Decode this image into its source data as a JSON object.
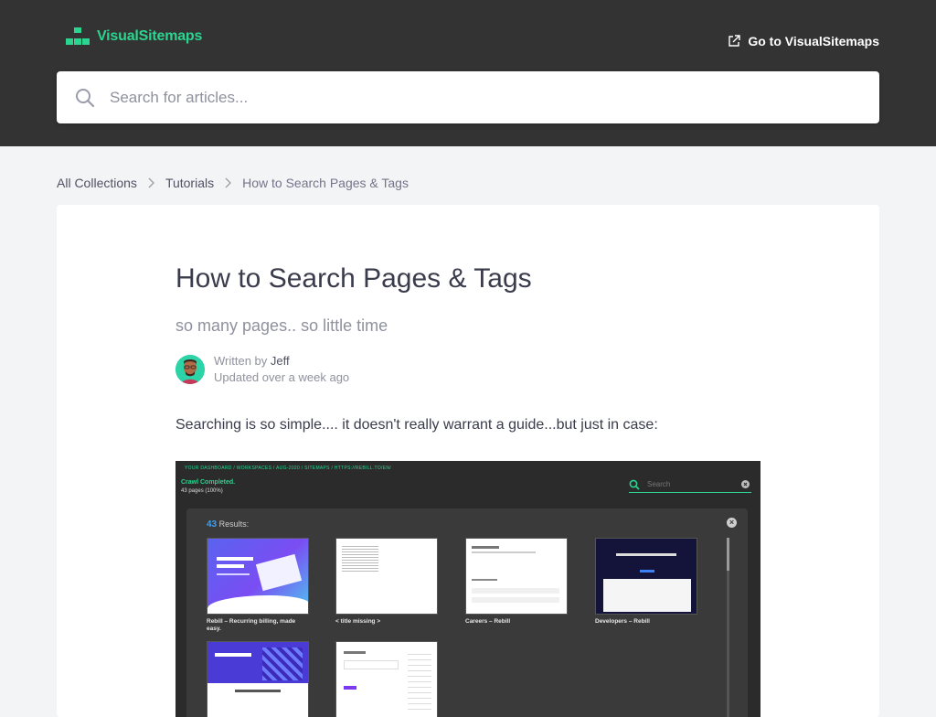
{
  "header": {
    "brand": "VisualSitemaps",
    "goto_label": "Go to VisualSitemaps",
    "search_placeholder": "Search for articles..."
  },
  "breadcrumb": {
    "items": [
      "All Collections",
      "Tutorials"
    ],
    "current": "How to Search Pages & Tags"
  },
  "article": {
    "title": "How to Search Pages & Tags",
    "subtitle": "so many pages.. so little time",
    "written_by": "Written by",
    "author": "Jeff",
    "updated": "Updated over a week ago",
    "intro": "Searching is so simple.... it doesn't really warrant a guide...but just in case:"
  },
  "screenshot": {
    "breadcrumb": "YOUR DASHBOARD  /  WORKSPACES  /  AUG-2020  /  SITEMAPS  /  HTTPS://REBILL.TO/EN/",
    "crawl_status": "Crawl Completed.",
    "pages_count": "43 pages",
    "pages_pct": "(100%)",
    "search_placeholder": "Search",
    "results_count": "43",
    "results_label": "Results:",
    "cards": [
      {
        "label": "Rebill – Recurring billing, made easy.",
        "style": "rebill"
      },
      {
        "label": "< title missing >",
        "style": "blank"
      },
      {
        "label": "Careers – Rebill",
        "style": "white"
      },
      {
        "label": "Developers – Rebill",
        "style": "dev"
      },
      {
        "label": "",
        "style": "fin"
      },
      {
        "label": "",
        "style": "white"
      }
    ]
  },
  "colors": {
    "brand_green": "#2bd48f",
    "header_bg": "#333333",
    "page_bg": "#f3f4f6"
  }
}
